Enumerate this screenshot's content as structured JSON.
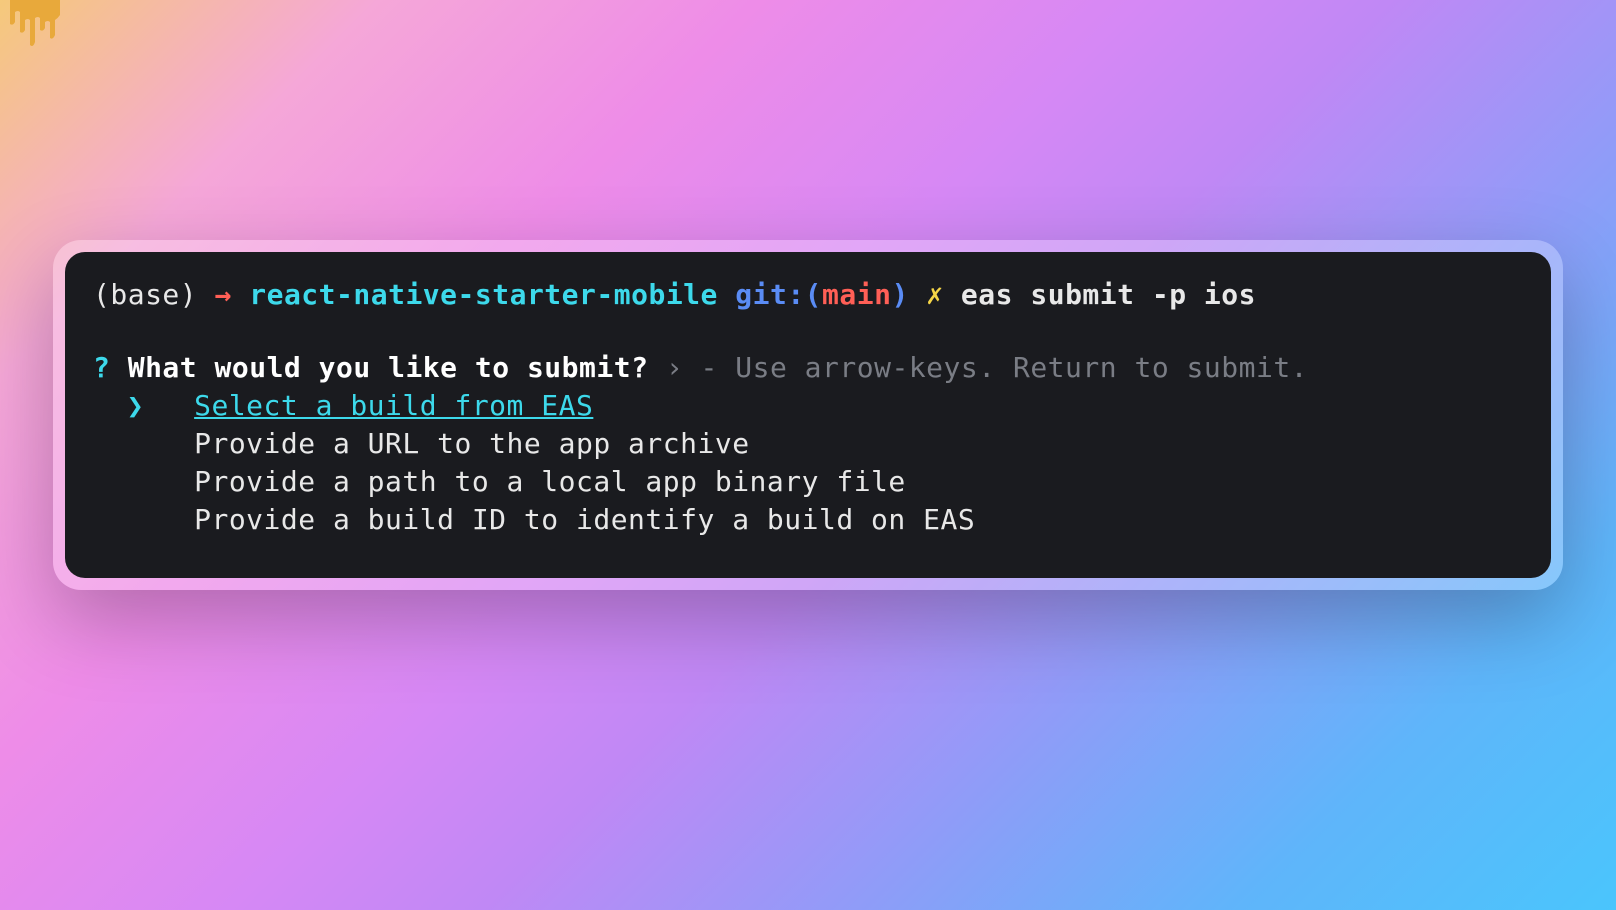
{
  "prompt": {
    "env": "(base)",
    "arrow": "→",
    "project": "react-native-starter-mobile",
    "git_prefix": "git:(",
    "branch": "main",
    "git_suffix": ")",
    "dirty_mark": "✗",
    "command": "eas submit -p ios"
  },
  "interactive": {
    "q_mark": "?",
    "question": "What would you like to submit?",
    "hint_chevron": "›",
    "hint": "- Use arrow-keys. Return to submit.",
    "pointer": "❯",
    "options": [
      {
        "label": "Select a build from EAS",
        "selected": true
      },
      {
        "label": "Provide a URL to the app archive",
        "selected": false
      },
      {
        "label": "Provide a path to a local app binary file",
        "selected": false
      },
      {
        "label": "Provide a build ID to identify a build on EAS",
        "selected": false
      }
    ]
  }
}
